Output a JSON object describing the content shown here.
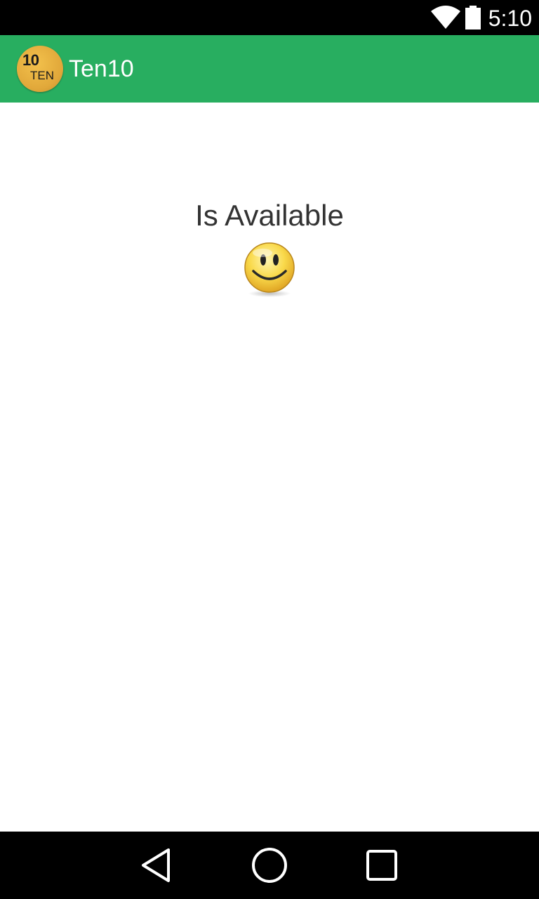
{
  "status_bar": {
    "time": "5:10",
    "icons": [
      "wifi-icon",
      "battery-icon"
    ]
  },
  "app_bar": {
    "title": "Ten10",
    "logo": {
      "line1": "10",
      "line2": "TEN"
    }
  },
  "main": {
    "status_text": "Is Available",
    "emoji": "smiley-face-icon"
  },
  "nav_bar": {
    "buttons": [
      "back-icon",
      "home-icon",
      "recents-icon"
    ]
  },
  "colors": {
    "app_bar": "#28ae60",
    "status_bar": "#000000",
    "text": "#333333",
    "logo": "#e1a83a"
  }
}
